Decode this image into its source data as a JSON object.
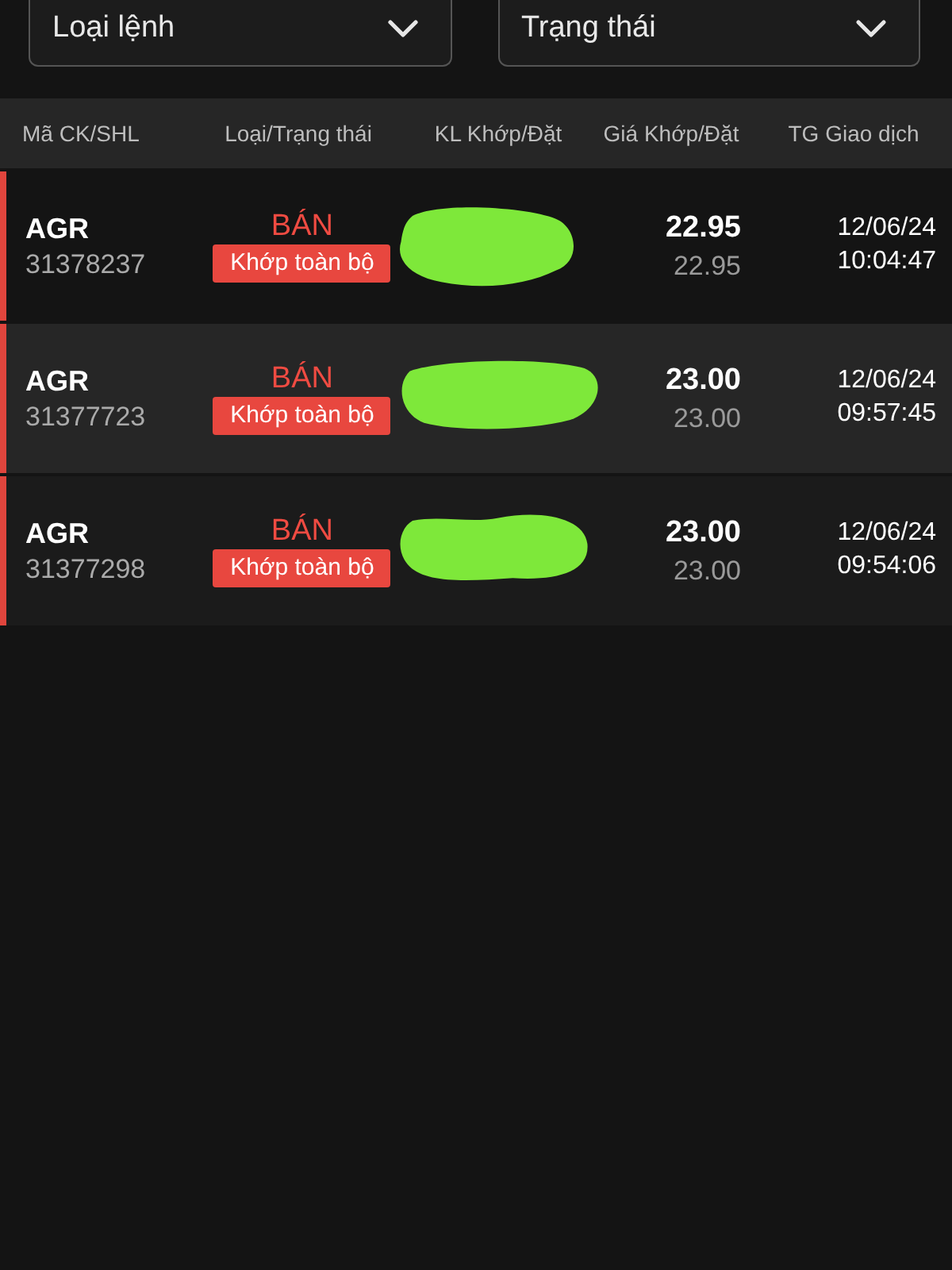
{
  "filters": [
    {
      "label": "Loại lệnh"
    },
    {
      "label": "Trạng thái"
    }
  ],
  "columns": [
    "Mã CK/SHL",
    "Loại/Trạng thái",
    "KL Khớp/Đặt",
    "Giá Khớp/Đặt",
    "TG Giao dịch"
  ],
  "orders": [
    {
      "symbol": "AGR",
      "order_no": "31378237",
      "side": "BÁN",
      "status": "Khớp toàn bộ",
      "matched_price": "22.95",
      "order_price": "22.95",
      "date": "12/06/24",
      "time": "10:04:47"
    },
    {
      "symbol": "AGR",
      "order_no": "31377723",
      "side": "BÁN",
      "status": "Khớp toàn bộ",
      "matched_price": "23.00",
      "order_price": "23.00",
      "date": "12/06/24",
      "time": "09:57:45"
    },
    {
      "symbol": "AGR",
      "order_no": "31377298",
      "side": "BÁN",
      "status": "Khớp toàn bộ",
      "matched_price": "23.00",
      "order_price": "23.00",
      "date": "12/06/24",
      "time": "09:54:06"
    }
  ]
}
